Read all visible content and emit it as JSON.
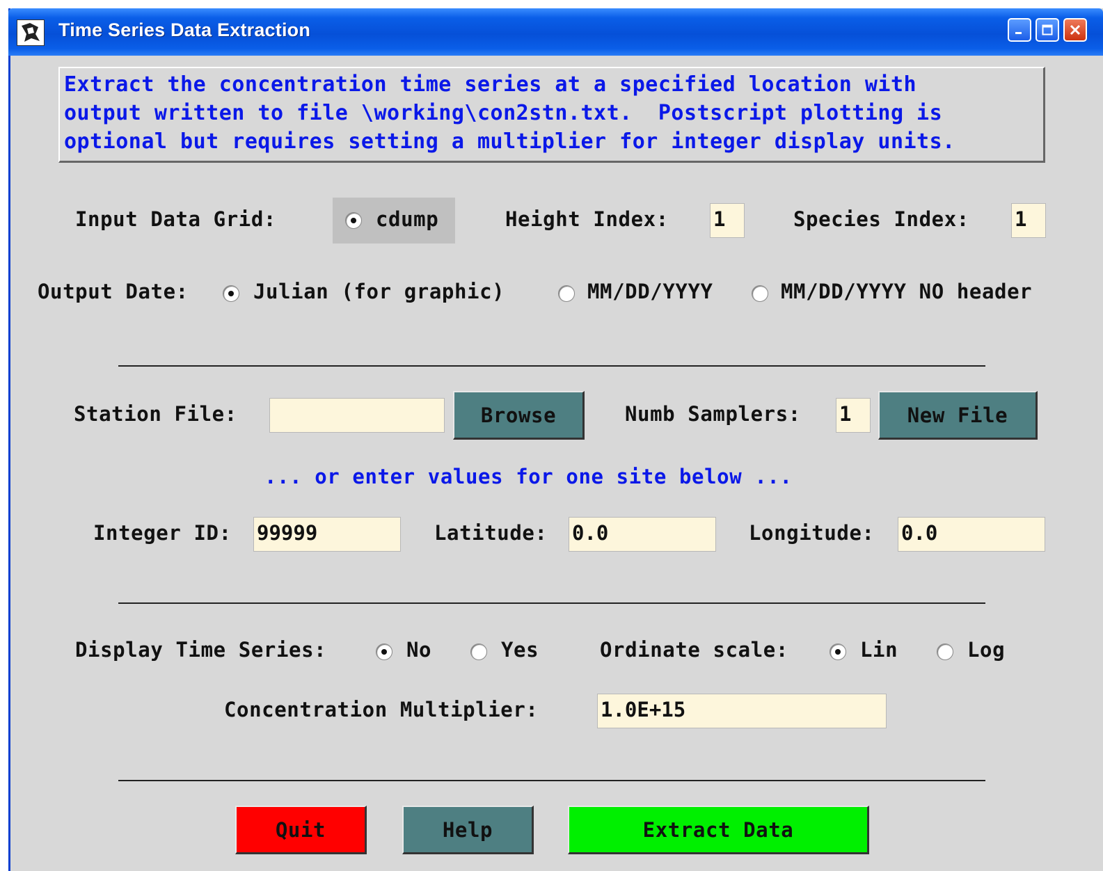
{
  "window": {
    "title": "Time Series Data Extraction"
  },
  "info": {
    "lines": [
      "Extract the concentration time series at a specified location with",
      "output written to file \\working\\con2stn.txt.  Postscript plotting is",
      "optional but requires setting a multiplier for integer display units."
    ]
  },
  "input_grid": {
    "label": "Input Data Grid:",
    "option": "cdump"
  },
  "height_index": {
    "label": "Height Index:",
    "value": "1"
  },
  "species_index": {
    "label": "Species Index:",
    "value": "1"
  },
  "output_date": {
    "label": "Output Date:",
    "options": [
      "Julian (for graphic)",
      "MM/DD/YYYY",
      "MM/DD/YYYY NO header"
    ],
    "selected": "Julian (for graphic)"
  },
  "station": {
    "label": "Station File:",
    "value": "",
    "browse_label": "Browse",
    "samplers_label": "Numb Samplers:",
    "samplers_value": "1",
    "new_file_label": "New File"
  },
  "hint": "... or enter values for one site below ...",
  "site": {
    "id_label": "Integer ID:",
    "id_value": "99999",
    "lat_label": "Latitude:",
    "lat_value": "0.0",
    "lon_label": "Longitude:",
    "lon_value": "0.0"
  },
  "display": {
    "label": "Display Time Series:",
    "options": [
      "No",
      "Yes"
    ],
    "selected": "No"
  },
  "ordinate": {
    "label": "Ordinate scale:",
    "options": [
      "Lin",
      "Log"
    ],
    "selected": "Lin"
  },
  "multiplier": {
    "label": "Concentration Multiplier:",
    "value": "1.0E+15"
  },
  "buttons": {
    "quit": "Quit",
    "help": "Help",
    "extract": "Extract Data"
  },
  "colors": {
    "info_text": "#0a18e8",
    "field_bg": "#fdf6dc",
    "teal_button": "#4e7f82",
    "quit_button": "#ff0000",
    "extract_button": "#00f000"
  }
}
